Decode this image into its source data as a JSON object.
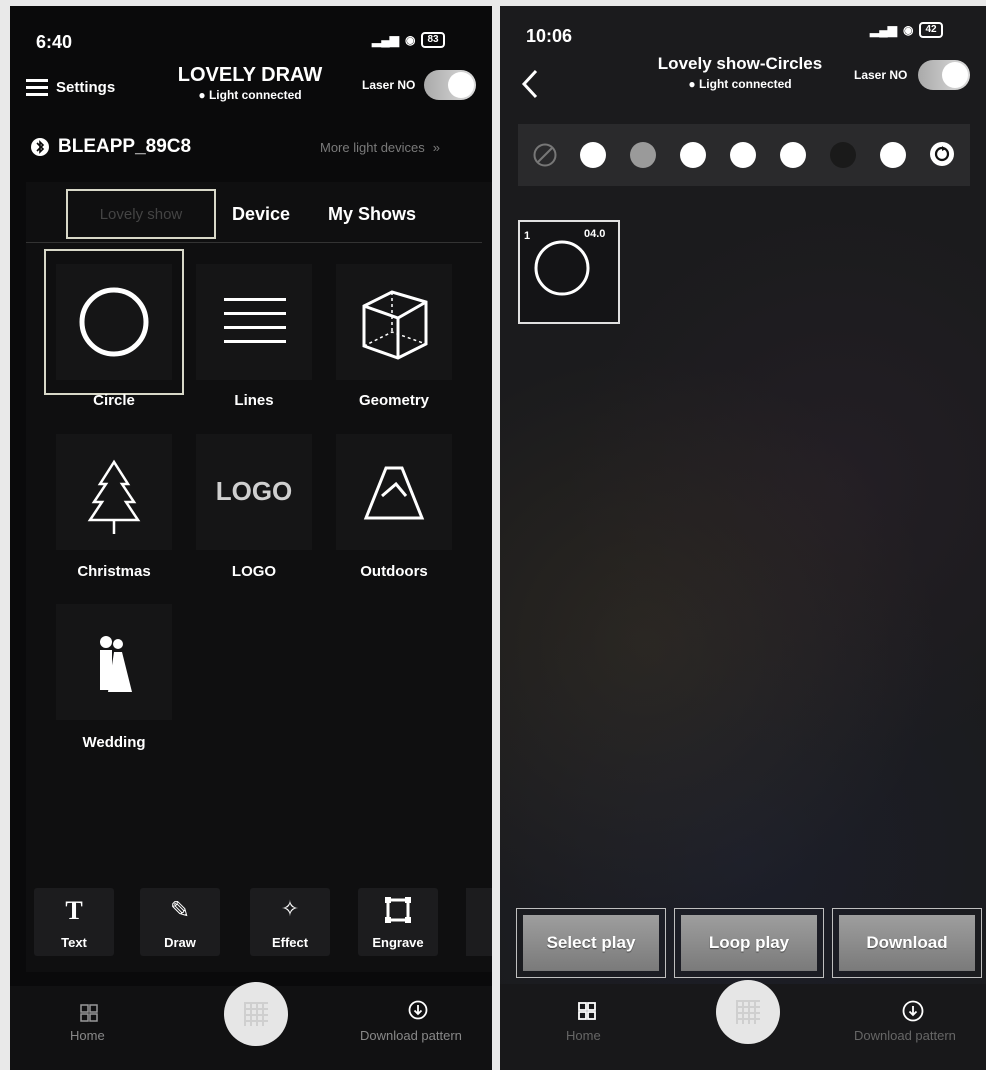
{
  "left": {
    "status": {
      "time": "6:40",
      "battery": "83"
    },
    "header": {
      "menu_label": "Settings",
      "title": "LOVELY DRAW",
      "connection": "Light connected",
      "laser_label": "Laser NO"
    },
    "device": {
      "name": "BLEAPP_89C8",
      "more_link": "More light devices"
    },
    "tabs": [
      "Lovely show",
      "Device",
      "My Shows"
    ],
    "categories": [
      {
        "label": "Circle",
        "icon": "circle-icon"
      },
      {
        "label": "Lines",
        "icon": "lines-icon"
      },
      {
        "label": "Geometry",
        "icon": "cube-icon"
      },
      {
        "label": "Christmas",
        "icon": "tree-icon"
      },
      {
        "label": "LOGO",
        "icon": "logo-text-icon",
        "icon_text": "LOGO"
      },
      {
        "label": "Outdoors",
        "icon": "mountain-icon"
      },
      {
        "label": "Wedding",
        "icon": "couple-icon"
      }
    ],
    "tools": [
      {
        "label": "Text",
        "icon": "text-icon"
      },
      {
        "label": "Draw",
        "icon": "pencil-icon"
      },
      {
        "label": "Effect",
        "icon": "wand-icon"
      },
      {
        "label": "Engrave",
        "icon": "crop-icon"
      }
    ],
    "nav": {
      "home": "Home",
      "download": "Download pattern"
    }
  },
  "right": {
    "status": {
      "time": "10:06",
      "battery": "42"
    },
    "header": {
      "title": "Lovely show-Circles",
      "connection": "Light connected",
      "laser_label": "Laser NO"
    },
    "pattern": {
      "index": "1",
      "value": "04.0"
    },
    "buttons": {
      "select": "Select play",
      "loop": "Loop play",
      "download": "Download"
    },
    "nav": {
      "home": "Home",
      "download": "Download pattern"
    },
    "colors": [
      "#ffffff",
      "#9a9a9a",
      "#ffffff",
      "#ffffff",
      "#ffffff",
      "#1a1a1a",
      "#ffffff"
    ]
  }
}
